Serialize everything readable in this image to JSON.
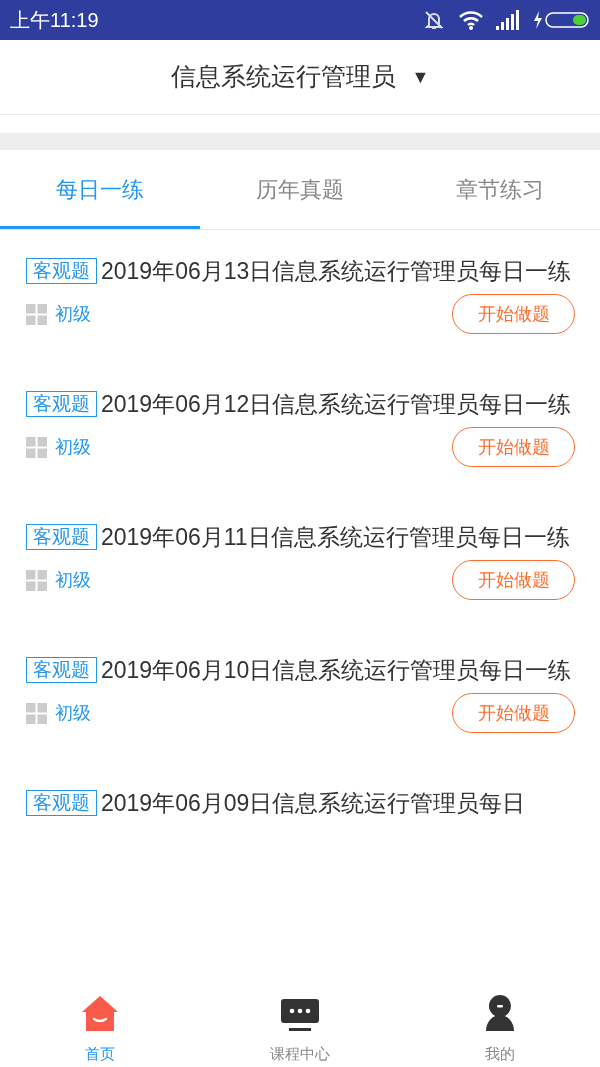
{
  "status_bar": {
    "time": "上午11:19"
  },
  "header": {
    "title": "信息系统运行管理员",
    "dropdown": "▼"
  },
  "tabs": [
    {
      "label": "每日一练",
      "selected": true
    },
    {
      "label": "历年真题",
      "selected": false
    },
    {
      "label": "章节练习",
      "selected": false
    }
  ],
  "items": [
    {
      "tag": "客观题",
      "title": "2019年06月13日信息系统运行管理员每日一练",
      "level": "初级",
      "button": "开始做题"
    },
    {
      "tag": "客观题",
      "title": "2019年06月12日信息系统运行管理员每日一练",
      "level": "初级",
      "button": "开始做题"
    },
    {
      "tag": "客观题",
      "title": "2019年06月11日信息系统运行管理员每日一练",
      "level": "初级",
      "button": "开始做题"
    },
    {
      "tag": "客观题",
      "title": "2019年06月10日信息系统运行管理员每日一练",
      "level": "初级",
      "button": "开始做题"
    },
    {
      "tag": "客观题",
      "title": "2019年06月09日信息系统运行管理员每日"
    }
  ],
  "bottom_nav": [
    {
      "label": "首页",
      "kind": "home",
      "selected": true
    },
    {
      "label": "课程中心",
      "kind": "course",
      "selected": false
    },
    {
      "label": "我的",
      "kind": "profile",
      "selected": false
    }
  ]
}
